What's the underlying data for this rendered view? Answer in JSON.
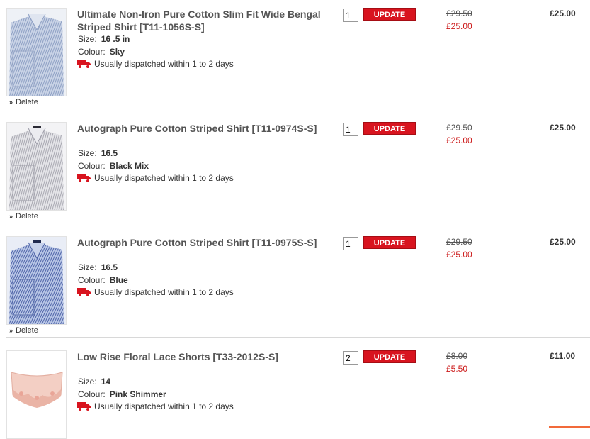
{
  "basket": {
    "update_label": "UPDATE",
    "delete_label": "Delete",
    "size_label": "Size:",
    "colour_label": "Colour:",
    "items": [
      {
        "title": "Ultimate Non-Iron Pure Cotton Slim Fit Wide Bengal Striped Shirt [T11-1056S-S]",
        "size": "16 .5 in",
        "colour": "Sky",
        "dispatch": "Usually dispatched within 1 to 2 days",
        "quantity": "1",
        "was_price": "£29.50",
        "now_price": "£25.00",
        "line_total": "£25.00"
      },
      {
        "title": "Autograph Pure Cotton Striped Shirt [T11-0974S-S]",
        "size": "16.5",
        "colour": "Black Mix",
        "dispatch": "Usually dispatched within 1 to 2 days",
        "quantity": "1",
        "was_price": "£29.50",
        "now_price": "£25.00",
        "line_total": "£25.00"
      },
      {
        "title": "Autograph Pure Cotton Striped Shirt [T11-0975S-S]",
        "size": "16.5",
        "colour": "Blue",
        "dispatch": "Usually dispatched within 1 to 2 days",
        "quantity": "1",
        "was_price": "£29.50",
        "now_price": "£25.00",
        "line_total": "£25.00"
      },
      {
        "title": "Low Rise Floral Lace Shorts [T33-2012S-S]",
        "size": "14",
        "colour": "Pink Shimmer",
        "dispatch": "Usually dispatched within 1 to 2 days",
        "quantity": "2",
        "was_price": "£8.00",
        "now_price": "£5.50",
        "line_total": "£11.00"
      }
    ]
  },
  "colors": {
    "update_button": "#d8141f",
    "sale_price": "#cc1a1a",
    "truck_icon": "#d8141f"
  }
}
